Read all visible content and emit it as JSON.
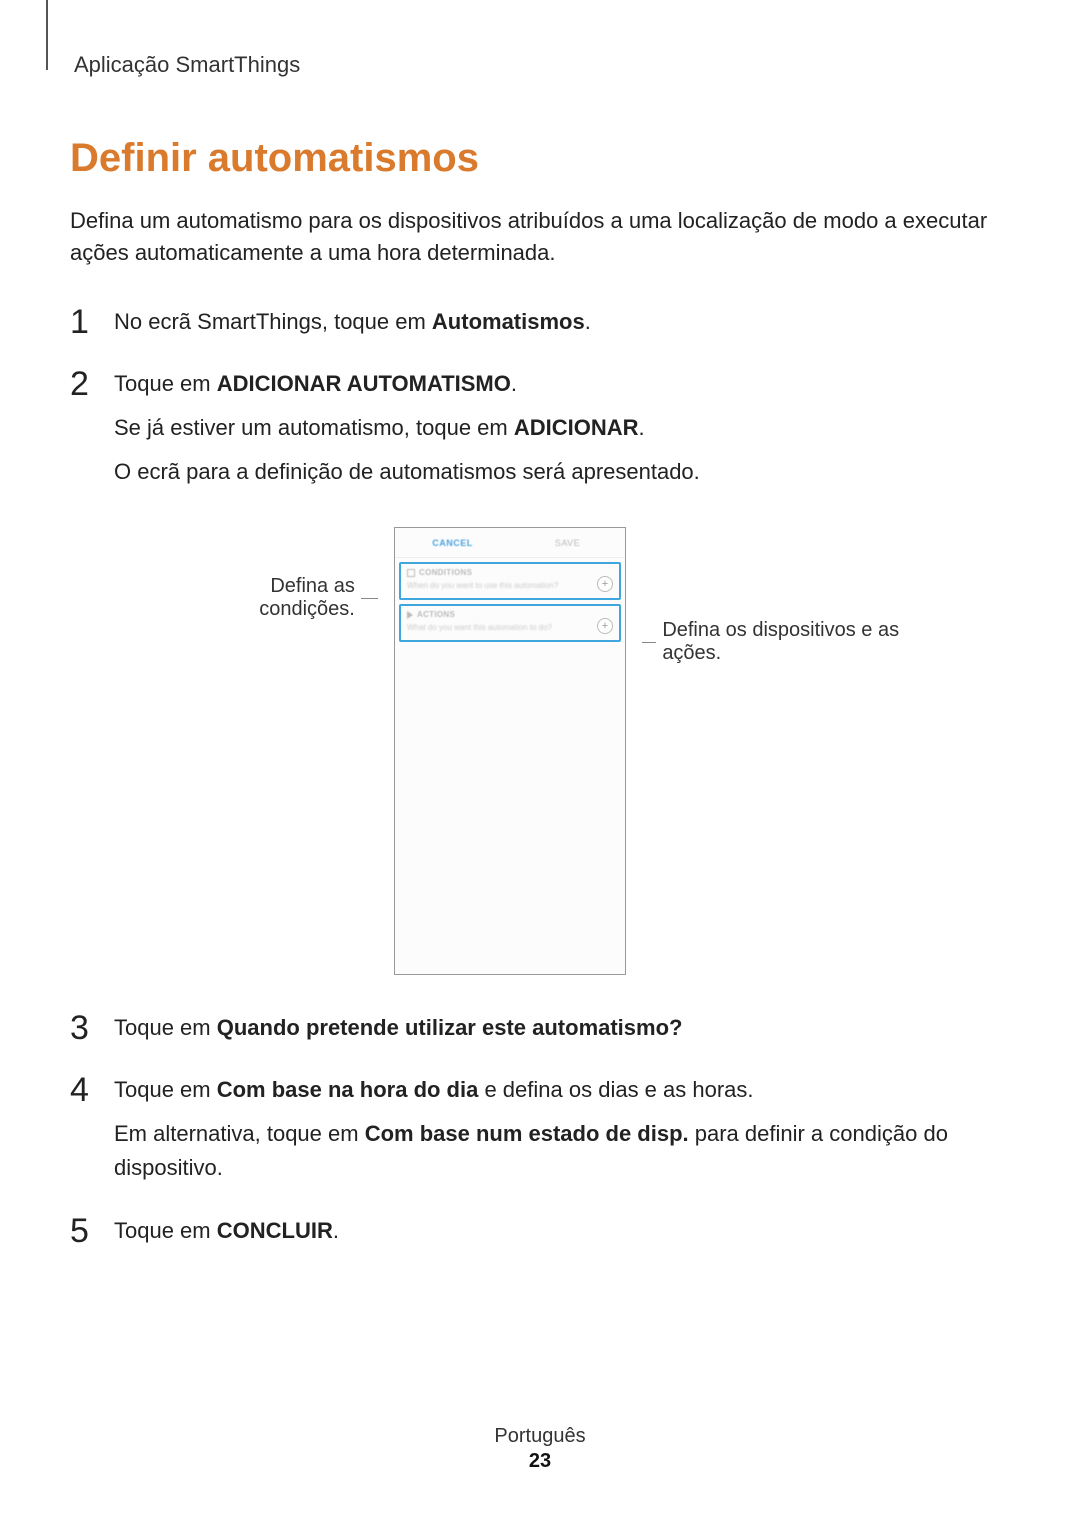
{
  "header": {
    "app": "Aplicação SmartThings"
  },
  "title": "Definir automatismos",
  "intro": "Defina um automatismo para os dispositivos atribuídos a uma localização de modo a executar ações automaticamente a uma hora determinada.",
  "steps": {
    "s1": {
      "num": "1",
      "text_a": "No ecrã SmartThings, toque em ",
      "text_b": "Automatismos",
      "text_c": "."
    },
    "s2": {
      "num": "2",
      "line1_a": "Toque em ",
      "line1_b": "ADICIONAR AUTOMATISMO",
      "line1_c": ".",
      "line2_a": "Se já estiver um automatismo, toque em ",
      "line2_b": "ADICIONAR",
      "line2_c": ".",
      "line3": "O ecrã para a definição de automatismos será apresentado."
    },
    "s3": {
      "num": "3",
      "text_a": "Toque em ",
      "text_b": "Quando pretende utilizar este automatismo?"
    },
    "s4": {
      "num": "4",
      "line1_a": "Toque em ",
      "line1_b": "Com base na hora do dia",
      "line1_c": " e defina os dias e as horas.",
      "line2_a": "Em alternativa, toque em ",
      "line2_b": "Com base num estado de disp.",
      "line2_c": " para definir a condição do dispositivo."
    },
    "s5": {
      "num": "5",
      "text_a": "Toque em ",
      "text_b": "CONCLUIR",
      "text_c": "."
    }
  },
  "callouts": {
    "left": "Defina as condições.",
    "right": "Defina os dispositivos e as ações."
  },
  "phone": {
    "tab_active": "CANCEL",
    "tab_inactive": "SAVE",
    "cond_label": "CONDITIONS",
    "cond_desc": "When do you want to use this automation?",
    "act_label": "ACTIONS",
    "act_desc": "What do you want this automation to do?",
    "plus": "+"
  },
  "footer": {
    "lang": "Português",
    "page": "23"
  }
}
